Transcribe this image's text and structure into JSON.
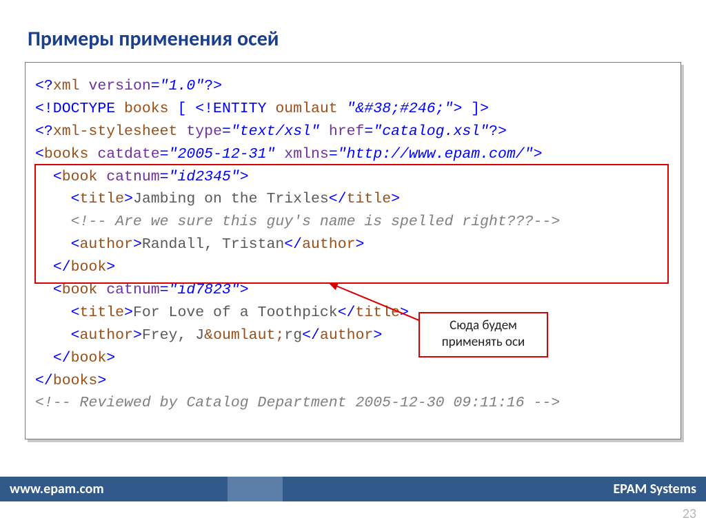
{
  "title": "Примеры применения осей",
  "code": {
    "declVersion": "\"1.0\"",
    "entityName": "oumlaut",
    "entityValue": "\"&#38;#246;\"",
    "stylesheetType": "\"text/xsl\"",
    "stylesheetHref": "\"catalog.xsl\"",
    "catdate": "\"2005-12-31\"",
    "xmlns": "\"http://www.epam.com/\"",
    "book1_catnum": "\"id2345\"",
    "book1_title": "Jambing on the Trixles",
    "book1_comment": "<!-- Are we sure this guy's name is spelled right???-->",
    "book1_author": "Randall, Tristan",
    "book2_catnum": "\"id7823\"",
    "book2_title": "For Love of a Toothpick",
    "book2_author_pre": "Frey, J",
    "book2_author_ent": "&oumlaut;",
    "book2_author_post": "rg",
    "final_comment": "<!-- Reviewed by Catalog Department 2005-12-30 09:11:16 -->"
  },
  "callout": {
    "line1": "Сюда будем",
    "line2": "применять оси"
  },
  "footer": {
    "left": "www.epam.com",
    "right": "EPAM Systems"
  },
  "pageNumber": "23"
}
